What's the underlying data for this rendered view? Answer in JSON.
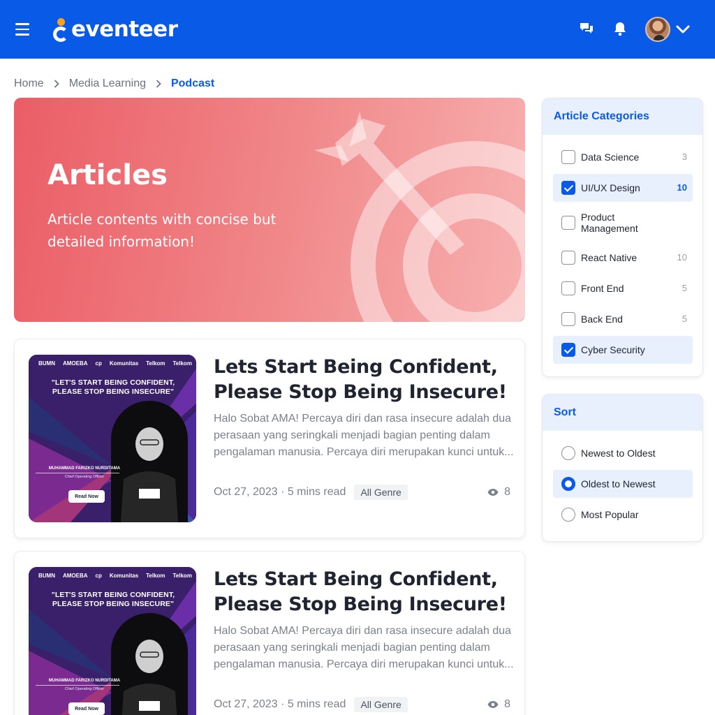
{
  "header": {
    "brand": "eventeer",
    "menu_icon": "hamburger-icon",
    "icons": [
      "chat-icon",
      "bell-icon",
      "chevron-down-icon"
    ],
    "brand_color": "#0a5ae8",
    "logo_dot_color": "#ffa21a"
  },
  "breadcrumb": {
    "items": [
      "Home",
      "Media Learning"
    ],
    "current": "Podcast"
  },
  "hero": {
    "title": "Articles",
    "subtitle": "Article contents with concise but detailed information!"
  },
  "articles": [
    {
      "title": "Lets Start Being Confident, Please Stop Being Insecure!",
      "excerpt": "Halo Sobat AMA! Percaya diri dan rasa insecure adalah dua perasaan yang seringkali menjadi bagian penting dalam pengalaman manusia. Percaya diri merupakan kunci untuk...",
      "meta": "Oct 27, 2023 · 5 mins read",
      "tag": "All Genre",
      "views": "8",
      "thumb": {
        "logos": [
          "BUMN",
          "AMOEBA",
          "cp",
          "Komunitas",
          "Telkom",
          "Telkom"
        ],
        "quote": "\"LET'S START BEING CONFIDENT, PLEASE STOP BEING INSECURE\"",
        "name": "MUHAMMAD FARIZKO NURDITAMA",
        "role": "Chief Operating Officer",
        "button": "Read Now"
      }
    },
    {
      "title": "Lets Start Being Confident, Please Stop Being Insecure!",
      "excerpt": "Halo Sobat AMA! Percaya diri dan rasa insecure adalah dua perasaan yang seringkali menjadi bagian penting dalam pengalaman manusia. Percaya diri merupakan kunci untuk...",
      "meta": "Oct 27, 2023 · 5 mins read",
      "tag": "All Genre",
      "views": "8",
      "thumb": {
        "logos": [
          "BUMN",
          "AMOEBA",
          "cp",
          "Komunitas",
          "Telkom",
          "Telkom"
        ],
        "quote": "\"LET'S START BEING CONFIDENT, PLEASE STOP BEING INSECURE\"",
        "name": "MUHAMMAD FARIZKO NURDITAMA",
        "role": "Chief Operating Officer",
        "button": "Read Now"
      }
    }
  ],
  "categories": {
    "title": "Article Categories",
    "items": [
      {
        "label": "Data Science",
        "count": "3",
        "checked": false
      },
      {
        "label": "UI/UX Design",
        "count": "10",
        "checked": true
      },
      {
        "label": "Product Management",
        "count": "",
        "checked": false
      },
      {
        "label": "React Native",
        "count": "10",
        "checked": false
      },
      {
        "label": "Front End",
        "count": "5",
        "checked": false
      },
      {
        "label": "Back End",
        "count": "5",
        "checked": false
      },
      {
        "label": "Cyber Security",
        "count": "",
        "checked": true
      }
    ]
  },
  "sort": {
    "title": "Sort",
    "options": [
      {
        "label": "Newest to Oldest",
        "selected": false
      },
      {
        "label": "Oldest to Newest",
        "selected": true
      },
      {
        "label": "Most Popular",
        "selected": false
      }
    ]
  }
}
